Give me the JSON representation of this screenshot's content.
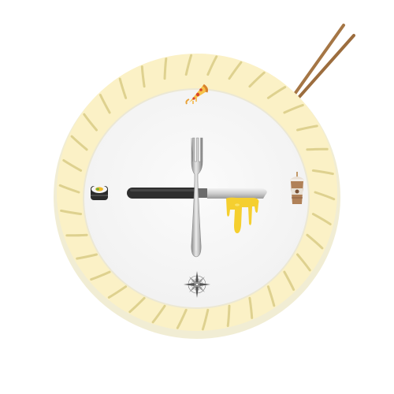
{
  "clock": {
    "type": "food-themed analog clock",
    "hour_markers": [
      {
        "position": 12,
        "icon": "pizza-slice-icon"
      },
      {
        "position": 3,
        "icon": "iced-coffee-cup-icon"
      },
      {
        "position": 6,
        "icon": "compass-rose-icon"
      },
      {
        "position": 9,
        "icon": "sushi-roll-icon"
      }
    ],
    "hands": {
      "hour_hand": "knife-icon",
      "minute_hand": "fork-icon",
      "second_hand": "black-bar"
    },
    "decoration": "chopsticks-icon",
    "colors": {
      "rim": "#fbf0c4",
      "rim_shadow": "#e6dca8",
      "rim_grooves": "#d6c87d",
      "face": "#f7f7f7",
      "knife_blade": "#d9d9d9",
      "melted_cheese": "#f6d23a",
      "chopsticks": "#a8794a"
    }
  }
}
